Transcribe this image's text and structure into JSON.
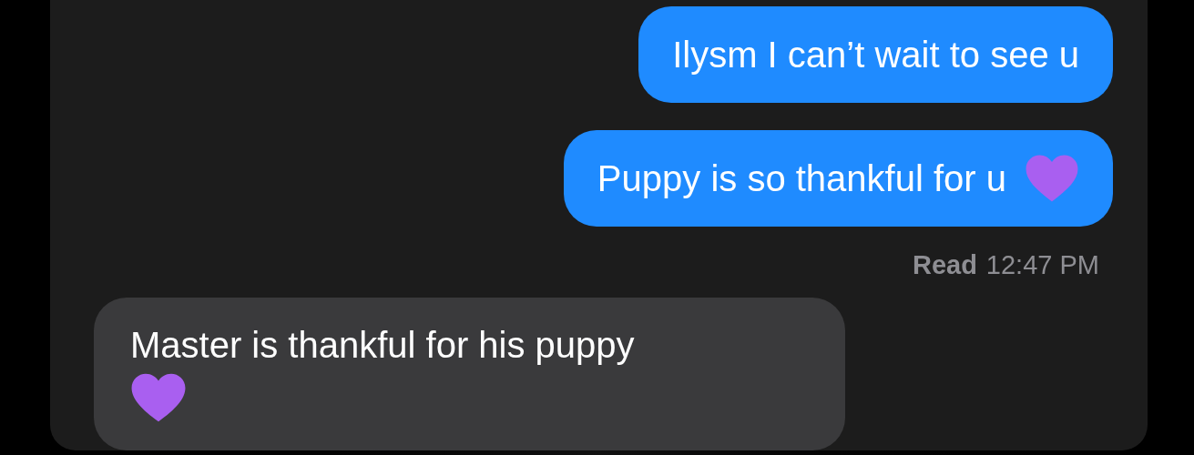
{
  "messages": [
    {
      "kind": "sent",
      "text": "Ilysm I can’t wait to see u",
      "heart": false
    },
    {
      "kind": "sent",
      "text": "Puppy is so thankful for u",
      "heart": true
    },
    {
      "kind": "receipt",
      "status": "Read",
      "time": "12:47 PM"
    },
    {
      "kind": "received",
      "text": "Master is thankful for his puppy",
      "heart": true
    }
  ]
}
